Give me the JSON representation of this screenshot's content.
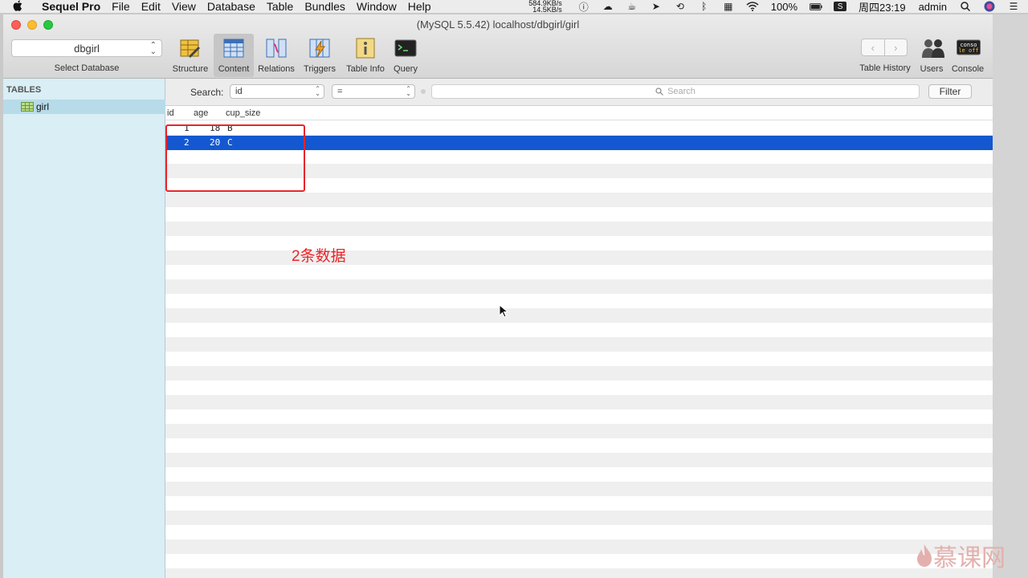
{
  "menubar": {
    "app_name": "Sequel Pro",
    "items": [
      "File",
      "Edit",
      "View",
      "Database",
      "Table",
      "Bundles",
      "Window",
      "Help"
    ],
    "net_up": "584.9KB/s",
    "net_down": "14.5KB/s",
    "battery": "100%",
    "clock": "周四23:19",
    "user": "admin"
  },
  "window": {
    "title": "(MySQL 5.5.42) localhost/dbgirl/girl"
  },
  "toolbar": {
    "database_value": "dbgirl",
    "database_label": "Select Database",
    "tools": [
      "Structure",
      "Content",
      "Relations",
      "Triggers",
      "Table Info",
      "Query"
    ],
    "active_tool": "Content",
    "table_history_label": "Table History",
    "users_label": "Users",
    "console_label": "Console"
  },
  "sidebar": {
    "header": "TABLES",
    "tables": [
      "girl"
    ]
  },
  "filter": {
    "search_label": "Search:",
    "field_value": "id",
    "operator_value": "=",
    "search_placeholder": "Search",
    "filter_button": "Filter"
  },
  "table": {
    "columns": [
      "id",
      "age",
      "cup_size"
    ],
    "rows": [
      {
        "id": "1",
        "age": "18",
        "cup_size": "B"
      },
      {
        "id": "2",
        "age": "20",
        "cup_size": "C"
      }
    ],
    "selected_row": 2
  },
  "annotation": {
    "text": "2条数据",
    "color": "#e8252a"
  },
  "watermark": "慕课网"
}
